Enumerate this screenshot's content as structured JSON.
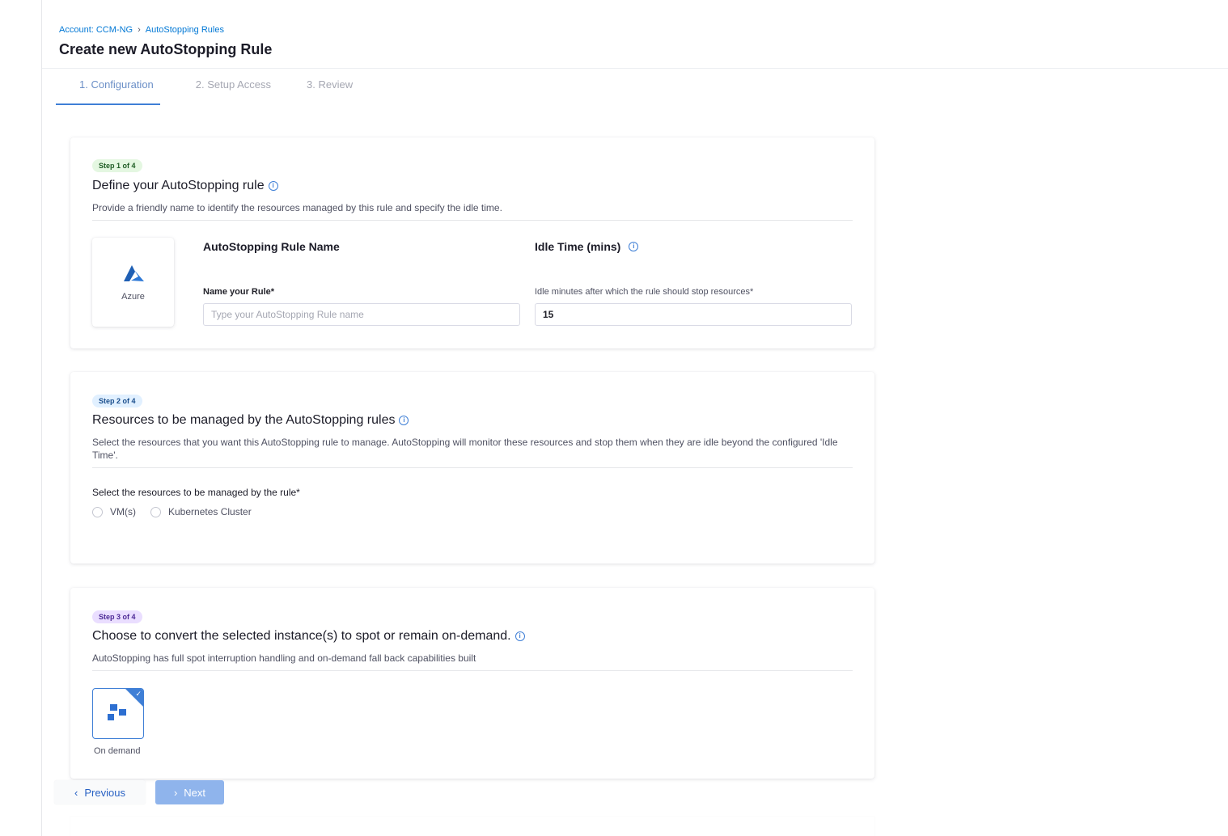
{
  "breadcrumb": {
    "account": "Account: CCM-NG",
    "separator": "›",
    "current": "AutoStopping Rules"
  },
  "page_title": "Create new AutoStopping Rule",
  "tabs": [
    {
      "label": "1. Configuration",
      "active": true
    },
    {
      "label": "2. Setup Access",
      "active": false
    },
    {
      "label": "3. Review",
      "active": false
    }
  ],
  "step1": {
    "badge": "Step 1 of 4",
    "title": "Define your AutoStopping rule",
    "description": "Provide a friendly name to identify the resources managed by this rule and specify the idle time.",
    "provider": {
      "label": "Azure",
      "icon": "azure-logo-icon"
    },
    "rule_name": {
      "heading": "AutoStopping Rule Name",
      "label": "Name your Rule*",
      "placeholder": "Type your AutoStopping Rule name",
      "value": ""
    },
    "idle_time": {
      "heading": "Idle Time (mins)",
      "label": "Idle minutes after which the rule should stop resources*",
      "value": "15"
    }
  },
  "step2": {
    "badge": "Step 2 of 4",
    "title": "Resources to be managed by the AutoStopping rules",
    "description": "Select the resources that you want this AutoStopping rule to manage. AutoStopping will monitor these resources and stop them when they are idle beyond the configured 'Idle Time'.",
    "select_label": "Select the resources to be managed by the rule*",
    "options": [
      {
        "label": "VM(s)",
        "selected": false
      },
      {
        "label": "Kubernetes Cluster",
        "selected": false
      }
    ]
  },
  "step3": {
    "badge": "Step 3 of 4",
    "title": "Choose to convert the selected instance(s) to spot or remain on-demand.",
    "description": "AutoStopping has full spot interruption handling and on-demand fall back capabilities built",
    "option": {
      "label": "On demand",
      "selected": true,
      "icon": "on-demand-icon"
    }
  },
  "footer": {
    "previous": "Previous",
    "next": "Next"
  },
  "colors": {
    "accent": "#3f7fd6",
    "link": "#0278d5",
    "next_disabled": "#8fb4ec"
  }
}
